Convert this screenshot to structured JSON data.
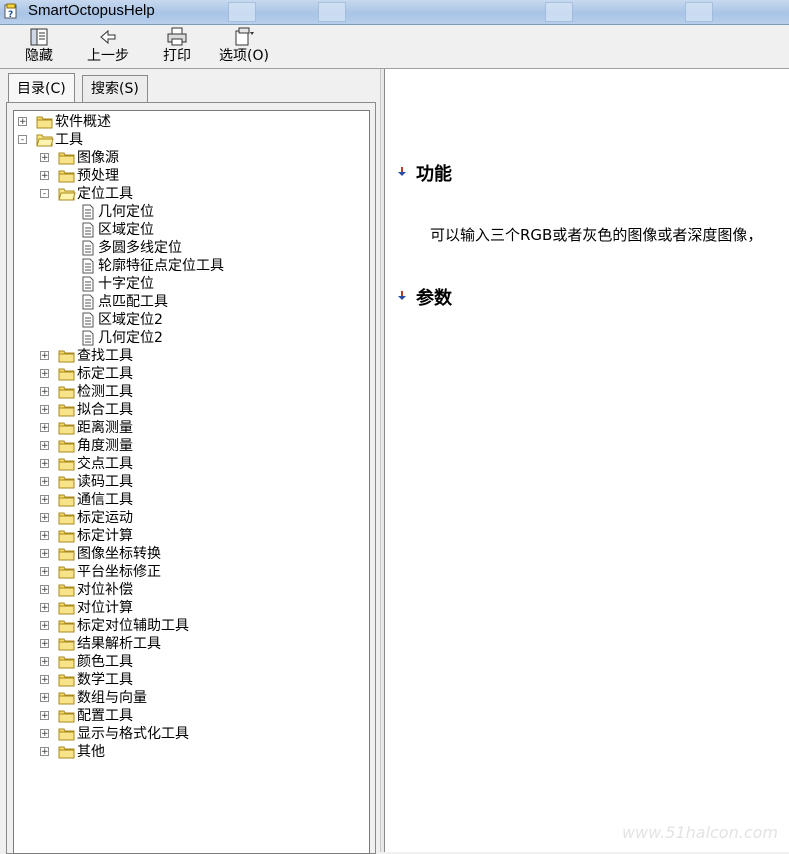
{
  "window": {
    "title": "SmartOctopusHelp"
  },
  "toolbar": {
    "hide_label": "隐藏",
    "back_label": "上一步",
    "print_label": "打印",
    "options_label": "选项(O)"
  },
  "tabs": {
    "contents_label": "目录(C)",
    "search_label": "搜索(S)"
  },
  "tree": [
    {
      "label": "软件概述",
      "level": 0,
      "kind": "folder",
      "expander": "+"
    },
    {
      "label": "工具",
      "level": 0,
      "kind": "folder-open",
      "expander": "-"
    },
    {
      "label": "图像源",
      "level": 1,
      "kind": "folder",
      "expander": "+"
    },
    {
      "label": "预处理",
      "level": 1,
      "kind": "folder",
      "expander": "+"
    },
    {
      "label": "定位工具",
      "level": 1,
      "kind": "folder-open",
      "expander": "-"
    },
    {
      "label": "几何定位",
      "level": 2,
      "kind": "page",
      "expander": ""
    },
    {
      "label": "区域定位",
      "level": 2,
      "kind": "page",
      "expander": ""
    },
    {
      "label": "多圆多线定位",
      "level": 2,
      "kind": "page",
      "expander": ""
    },
    {
      "label": "轮廓特征点定位工具",
      "level": 2,
      "kind": "page",
      "expander": ""
    },
    {
      "label": "十字定位",
      "level": 2,
      "kind": "page",
      "expander": ""
    },
    {
      "label": "点匹配工具",
      "level": 2,
      "kind": "page",
      "expander": ""
    },
    {
      "label": "区域定位2",
      "level": 2,
      "kind": "page",
      "expander": ""
    },
    {
      "label": "几何定位2",
      "level": 2,
      "kind": "page",
      "expander": ""
    },
    {
      "label": "查找工具",
      "level": 1,
      "kind": "folder",
      "expander": "+"
    },
    {
      "label": "标定工具",
      "level": 1,
      "kind": "folder",
      "expander": "+"
    },
    {
      "label": "检测工具",
      "level": 1,
      "kind": "folder",
      "expander": "+"
    },
    {
      "label": "拟合工具",
      "level": 1,
      "kind": "folder",
      "expander": "+"
    },
    {
      "label": "距离测量",
      "level": 1,
      "kind": "folder",
      "expander": "+"
    },
    {
      "label": "角度测量",
      "level": 1,
      "kind": "folder",
      "expander": "+"
    },
    {
      "label": "交点工具",
      "level": 1,
      "kind": "folder",
      "expander": "+"
    },
    {
      "label": "读码工具",
      "level": 1,
      "kind": "folder",
      "expander": "+"
    },
    {
      "label": "通信工具",
      "level": 1,
      "kind": "folder",
      "expander": "+"
    },
    {
      "label": "标定运动",
      "level": 1,
      "kind": "folder",
      "expander": "+"
    },
    {
      "label": "标定计算",
      "level": 1,
      "kind": "folder",
      "expander": "+"
    },
    {
      "label": "图像坐标转换",
      "level": 1,
      "kind": "folder",
      "expander": "+"
    },
    {
      "label": "平台坐标修正",
      "level": 1,
      "kind": "folder",
      "expander": "+"
    },
    {
      "label": "对位补偿",
      "level": 1,
      "kind": "folder",
      "expander": "+"
    },
    {
      "label": "对位计算",
      "level": 1,
      "kind": "folder",
      "expander": "+"
    },
    {
      "label": "标定对位辅助工具",
      "level": 1,
      "kind": "folder",
      "expander": "+"
    },
    {
      "label": "结果解析工具",
      "level": 1,
      "kind": "folder",
      "expander": "+"
    },
    {
      "label": "颜色工具",
      "level": 1,
      "kind": "folder",
      "expander": "+"
    },
    {
      "label": "数学工具",
      "level": 1,
      "kind": "folder",
      "expander": "+"
    },
    {
      "label": "数组与向量",
      "level": 1,
      "kind": "folder",
      "expander": "+"
    },
    {
      "label": "配置工具",
      "level": 1,
      "kind": "folder",
      "expander": "+"
    },
    {
      "label": "显示与格式化工具",
      "level": 1,
      "kind": "folder",
      "expander": "+"
    },
    {
      "label": "其他",
      "level": 1,
      "kind": "folder",
      "expander": "+"
    }
  ],
  "content": {
    "section_function": "功能",
    "description": "可以输入三个RGB或者灰色的图像或者深度图像，",
    "section_params": "参数"
  },
  "watermark": "www.51halcon.com"
}
